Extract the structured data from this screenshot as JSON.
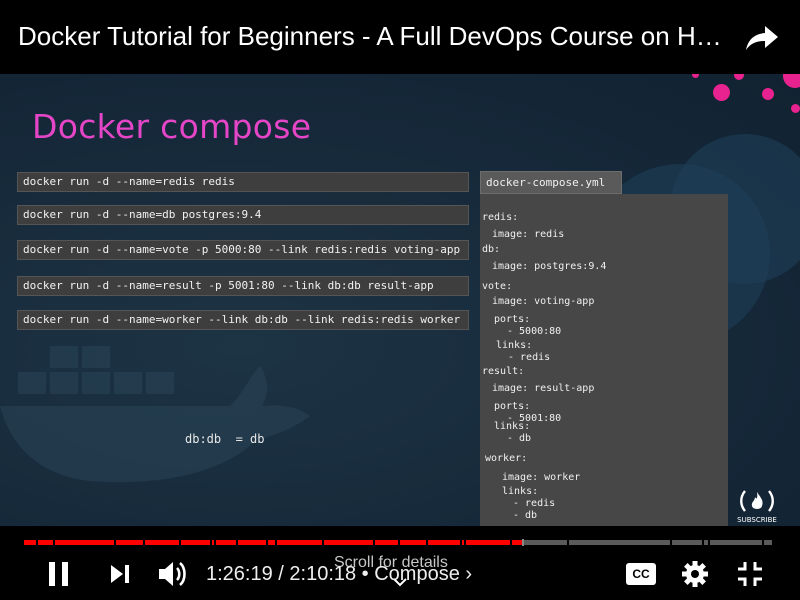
{
  "header": {
    "video_title": "Docker Tutorial for Beginners - A Full DevOps Course on H…",
    "share_icon": "share-arrow-icon"
  },
  "slide": {
    "title": "Docker compose",
    "commands": [
      "docker run -d --name=redis redis",
      "docker run -d --name=db postgres:9.4",
      "docker run -d --name=vote -p 5000:80 --link redis:redis voting-app",
      "docker run -d --name=result -p 5001:80 --link db:db result-app",
      "docker run -d --name=worker --link db:db --link redis:redis worker"
    ],
    "compose_filename": "docker-compose.yml",
    "compose_lines": [
      "redis:",
      "image: redis",
      "db:",
      "image: postgres:9.4",
      "vote:",
      "image: voting-app",
      "ports:",
      "- 5000:80",
      "links:",
      "- redis",
      "result:",
      "image: result-app",
      "ports:",
      "- 5001:80",
      "links:",
      "- db",
      "worker:",
      "image: worker",
      "links:",
      "- redis",
      "- db"
    ],
    "link_note": "db:db  = db",
    "logo_text": "SUBSCRIBE",
    "colors": {
      "title": "#e545c7",
      "accent_dots": "#e8238f",
      "background": "#16293a"
    }
  },
  "controls": {
    "time_display": "1:26:19 / 2:10:18 • Compose",
    "chapter_chevron": "›",
    "scroll_hint": "Scroll for details",
    "progress_played": 0.665,
    "progress_color": "#ff0000",
    "icons": {
      "play_pause": "pause-icon",
      "next": "next-icon",
      "volume": "volume-icon",
      "captions": "captions-icon",
      "settings": "gear-icon",
      "fullscreen": "exit-fullscreen-icon"
    },
    "captions_label": "CC"
  }
}
